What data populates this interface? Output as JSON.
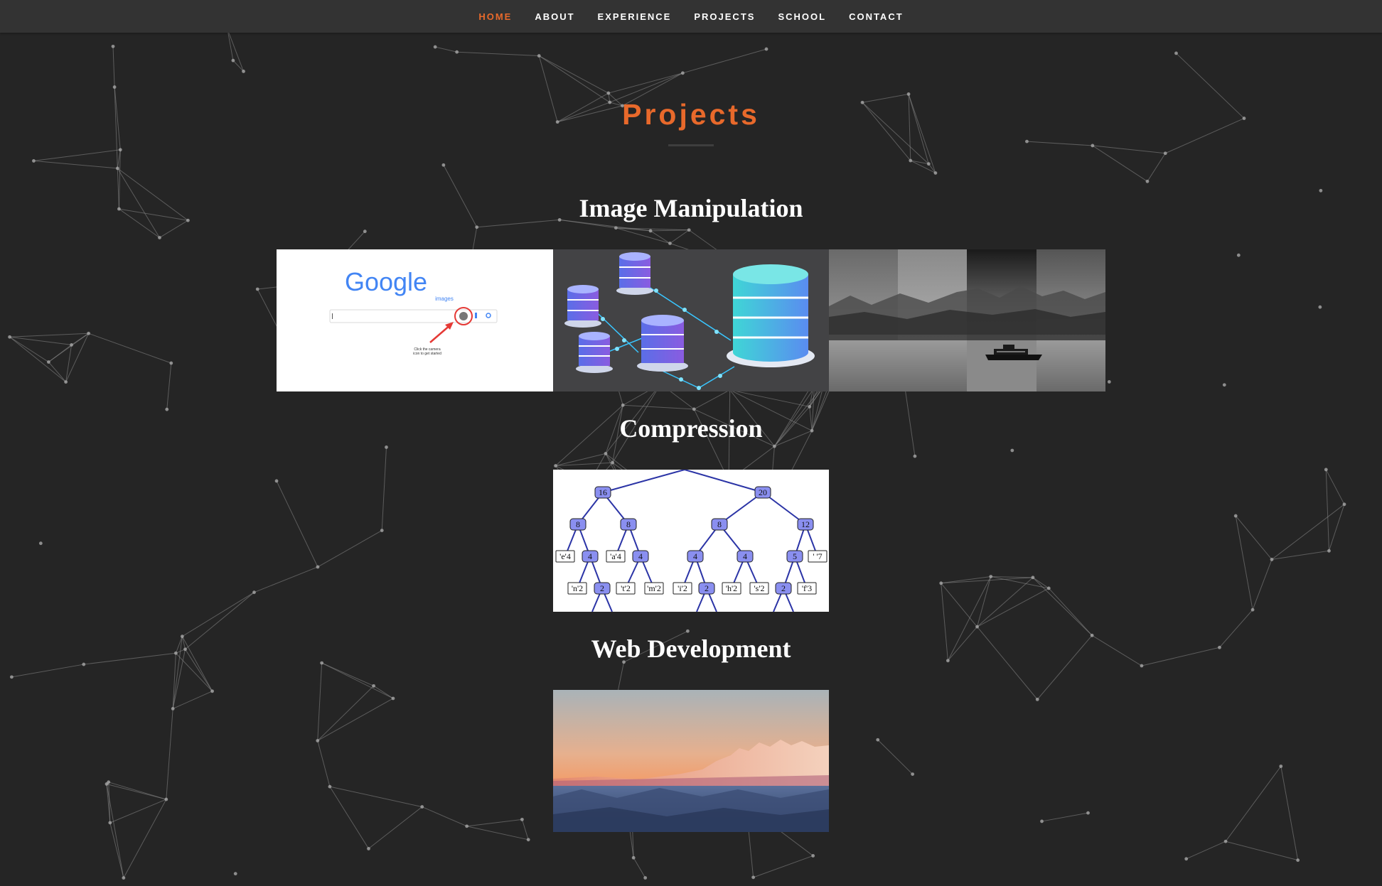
{
  "nav": {
    "items": [
      {
        "label": "HOME",
        "active": true
      },
      {
        "label": "ABOUT",
        "active": false
      },
      {
        "label": "EXPERIENCE",
        "active": false
      },
      {
        "label": "PROJECTS",
        "active": false
      },
      {
        "label": "SCHOOL",
        "active": false
      },
      {
        "label": "CONTACT",
        "active": false
      }
    ]
  },
  "page": {
    "title": "Projects"
  },
  "categories": [
    {
      "title": "Image Manipulation"
    },
    {
      "title": "Compression"
    },
    {
      "title": "Web Development"
    }
  ],
  "projects": {
    "google_search": {
      "logo": "Google",
      "logo_sub": "images",
      "caption_line1": "Click the camera",
      "caption_line2": "icon to get started"
    },
    "huffman_tree": {
      "root_left": "16",
      "root_right": "20",
      "l2": [
        "8",
        "8",
        "8",
        "12"
      ],
      "l3": [
        "'e'4",
        "4",
        "'a'4",
        "4",
        "4",
        "4",
        "5",
        "' '7"
      ],
      "l4": [
        "'n'2",
        "2",
        "'t'2",
        "'m'2",
        "'i'2",
        "2",
        "'h'2",
        "'s'2",
        "2",
        "'f'3"
      ]
    }
  },
  "colors": {
    "accent": "#e8692b",
    "background": "#252525",
    "navbar": "#333333"
  }
}
